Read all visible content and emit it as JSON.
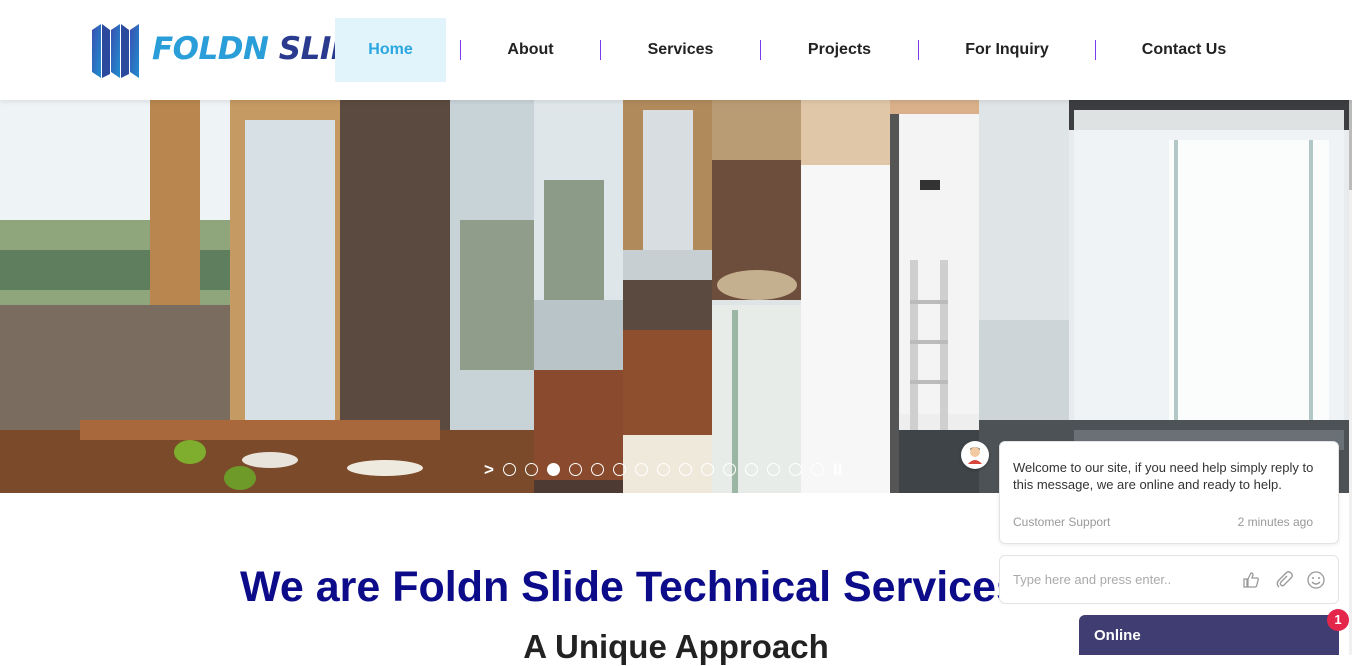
{
  "logo": {
    "text_part1": "FOLDN",
    "text_part2": "SLIDE"
  },
  "nav": {
    "items": [
      {
        "label": "Home"
      },
      {
        "label": "About"
      },
      {
        "label": "Services"
      },
      {
        "label": "Projects"
      },
      {
        "label": "For Inquiry"
      },
      {
        "label": "Contact Us"
      }
    ]
  },
  "slider": {
    "prev_icon": "chevron-right-icon",
    "pause_icon": "pause-icon",
    "active_slide": 3,
    "slide_count": 16
  },
  "main": {
    "title": "We are Foldn Slide Technical Services",
    "subtitle": "A Unique Approach"
  },
  "chat": {
    "message": "Welcome to our site, if you need help simply reply to this message, we are online and ready to help.",
    "from": "Customer Support",
    "time": "2 minutes ago",
    "input_placeholder": "Type here and press enter..",
    "status": "Online",
    "badge_count": "1"
  },
  "colors": {
    "nav_active_bg": "#e2f4fb",
    "nav_active_text": "#2aa6e0",
    "nav_separator": "#7c3aed",
    "title": "#0c0c8a",
    "chat_status_bg": "#3f3d72",
    "badge": "#e4264a"
  }
}
